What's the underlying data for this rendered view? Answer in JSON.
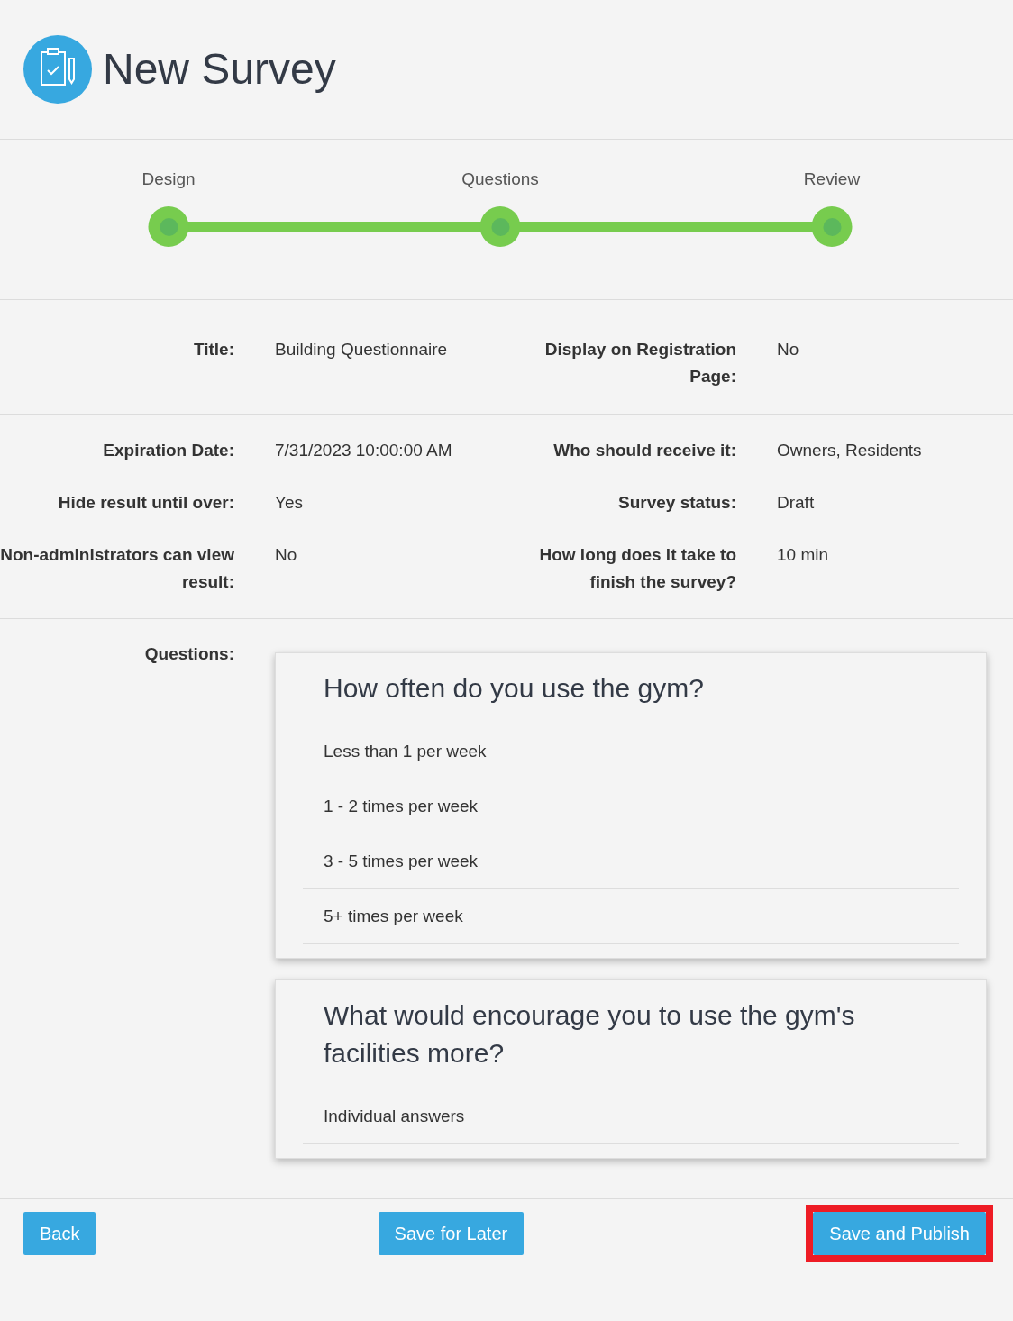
{
  "title": "New Survey",
  "steps": [
    {
      "label": "Design",
      "completed": true
    },
    {
      "label": "Questions",
      "completed": true
    },
    {
      "label": "Review",
      "completed": true
    }
  ],
  "summary_rows": [
    {
      "fields": [
        {
          "label": "Title:",
          "value": "Building Questionnaire"
        },
        {
          "label": "Display on Registration Page:",
          "value": "No"
        }
      ]
    },
    {
      "fields": [
        {
          "label": "Expiration Date:",
          "value": "7/31/2023 10:00:00 AM"
        },
        {
          "label": "Who should receive it:",
          "value": "Owners, Residents"
        }
      ]
    },
    {
      "fields": [
        {
          "label": "Hide result until over:",
          "value": "Yes"
        },
        {
          "label": "Survey status:",
          "value": "Draft"
        }
      ]
    },
    {
      "fields": [
        {
          "label": "Non-administrators can view result:",
          "value": "No"
        },
        {
          "label": "How long does it take to finish the survey?",
          "value": "10 min"
        }
      ]
    }
  ],
  "questions_label": "Questions:",
  "questions": [
    {
      "text": "How often do you use the gym?",
      "answers": [
        "Less than 1 per week",
        "1 - 2 times per week",
        "3 - 5 times per week",
        "5+ times per week"
      ]
    },
    {
      "text": "What would encourage you to use the gym's facilities more?",
      "answers": [
        "Individual answers"
      ]
    }
  ],
  "buttons": [
    {
      "label": "Back",
      "highlighted": false
    },
    {
      "label": "Save for Later",
      "highlighted": false
    },
    {
      "label": "Save and Publish",
      "highlighted": true
    }
  ]
}
